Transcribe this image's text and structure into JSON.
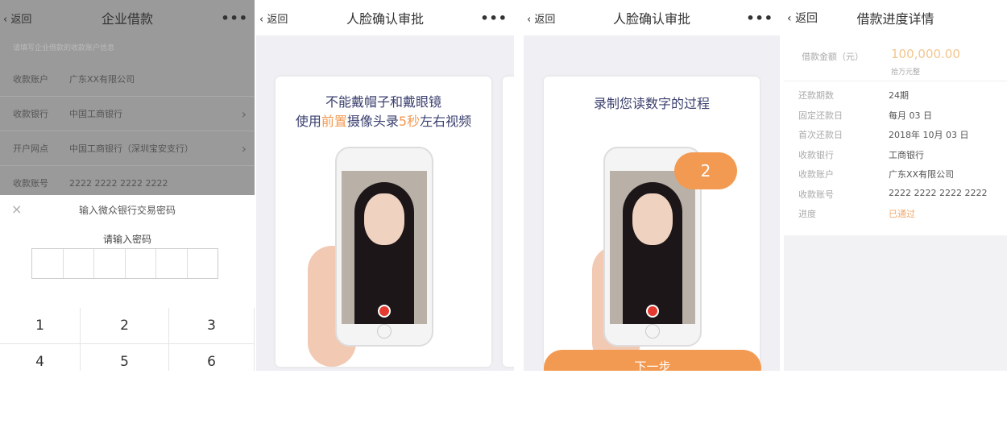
{
  "screen1": {
    "back": "返回",
    "title": "企业借款",
    "more": "•••",
    "hint": "请填写企业借款的收款账户信息",
    "rows": [
      {
        "k": "收款账户",
        "v": "广东XX有限公司"
      },
      {
        "k": "收款银行",
        "v": "中国工商银行"
      },
      {
        "k": "开户网点",
        "v": "中国工商银行（深圳宝安支行）"
      },
      {
        "k": "收款账号",
        "v": "2222 2222 2222 2222"
      }
    ],
    "sheet_title": "输入微众银行交易密码",
    "sheet_sub": "请输入密码",
    "close": "×",
    "keys": [
      "1",
      "2",
      "3",
      "4",
      "5",
      "6"
    ]
  },
  "screen2": {
    "back": "返回",
    "title": "人脸确认审批",
    "more": "•••",
    "line1": "不能戴帽子和戴眼镜",
    "line2a": "使用",
    "line2b": "前置",
    "line2c": "摄像头录",
    "line2d": "5秒",
    "line2e": "左右视频"
  },
  "screen3": {
    "back": "返回",
    "title": "人脸确认审批",
    "more": "•••",
    "heading": "录制您读数字的过程",
    "digit": "2",
    "next": "下一步"
  },
  "screen4": {
    "back": "返回",
    "title": "借款进度详情",
    "amount_label": "借款金额（元）",
    "amount": "100,000.00",
    "amount_sub": "拾万元整",
    "rows": [
      {
        "k": "还款期数",
        "v": "24期"
      },
      {
        "k": "固定还款日",
        "v": "每月 03 日"
      },
      {
        "k": "首次还款日",
        "v": "2018年 10月 03 日"
      },
      {
        "k": "收款银行",
        "v": "工商银行"
      },
      {
        "k": "收款账户",
        "v": "广东XX有限公司"
      },
      {
        "k": "收款账号",
        "v": "2222 2222 2222 2222"
      },
      {
        "k": "进度",
        "v": "已通过"
      }
    ]
  },
  "colors": {
    "accent": "#f39a52",
    "overlay": "#9a9a9a",
    "heading": "#3a3f6e"
  }
}
